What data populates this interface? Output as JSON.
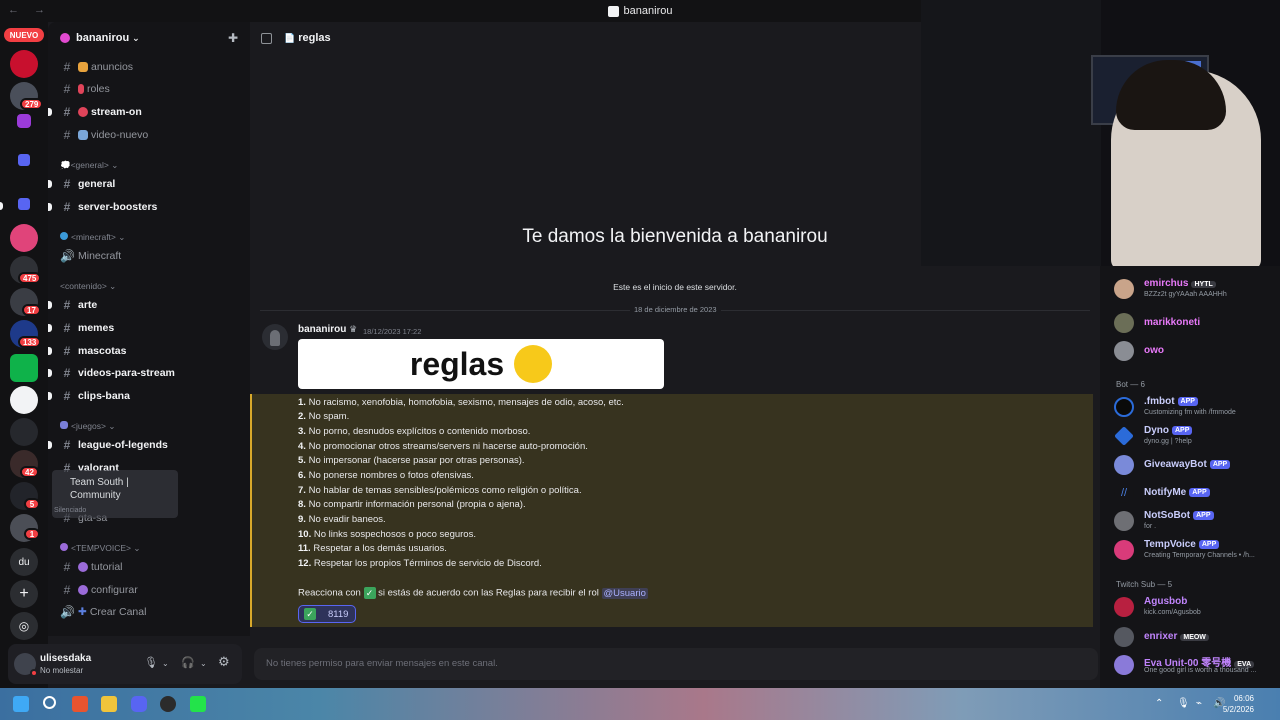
{
  "window": {
    "title": "bananirou",
    "nav": "← →"
  },
  "rail": {
    "nuevo_label": "NUEVO",
    "badges": [
      "279",
      "475",
      "17",
      "133",
      "42",
      "5",
      "1"
    ],
    "du_label": "du",
    "add_icon": "plus-icon",
    "discover_icon": "compass-icon"
  },
  "sidebar": {
    "server_name": "bananirou",
    "channels_top": [
      {
        "name": "anuncios",
        "bold": false
      },
      {
        "name": "roles",
        "bold": false
      },
      {
        "name": "stream-on",
        "bold": true
      },
      {
        "name": "video-nuevo",
        "bold": false
      }
    ],
    "cat_general": "💭<general>",
    "channels_general": [
      "general",
      "server-boosters"
    ],
    "cat_minecraft": "<minecraft>",
    "channel_minecraft": "Minecraft",
    "cat_contenido": "<contenido>",
    "channels_contenido": [
      "arte",
      "memes",
      "mascotas",
      "videos-para-stream",
      "clips-bana"
    ],
    "cat_juegos": "<juegos>",
    "channels_juegos": [
      "league-of-legends",
      "valorant",
      "gta-sa"
    ],
    "hover_card": {
      "line1": "Team South |",
      "line2": "Community",
      "sub": "Silenciado"
    },
    "cat_tempvoice": "<TEMPVOICE>",
    "channels_tempvoice": [
      "tutorial",
      "configurar",
      "Crear Canal"
    ]
  },
  "user_panel": {
    "name": "ulisesdaka",
    "status": "No molestar"
  },
  "chat": {
    "channel_name": "reglas",
    "welcome_title": "Te damos la bienvenida a bananirou",
    "welcome_sub": "Este es el inicio de este servidor.",
    "date_divider": "18 de diciembre de 2023",
    "author": "bananirou",
    "timestamp": "18/12/2023 17:22",
    "image_text": "reglas",
    "rules": [
      {
        "n": "1.",
        "t": "No racismo, xenofobia, homofobia, sexismo, mensajes de odio, acoso, etc."
      },
      {
        "n": "2.",
        "t": "No spam."
      },
      {
        "n": "3.",
        "t": "No porno, desnudos explícitos o contenido morboso."
      },
      {
        "n": "4.",
        "t": "No promocionar otros streams/servers ni hacerse auto-promoción."
      },
      {
        "n": "5.",
        "t": "No impersonar (hacerse pasar por otras personas)."
      },
      {
        "n": "6.",
        "t": "No ponerse nombres o fotos ofensivas."
      },
      {
        "n": "7.",
        "t": "No hablar de temas sensibles/polémicos como religión o política."
      },
      {
        "n": "8.",
        "t": "No compartir información personal (propia o ajena)."
      },
      {
        "n": "9.",
        "t": "No evadir baneos."
      },
      {
        "n": "10.",
        "t": "No links sospechosos o poco seguros."
      },
      {
        "n": "11.",
        "t": "Respetar a los demás usuarios."
      },
      {
        "n": "12.",
        "t": "Respetar los propios Términos de servicio de Discord."
      }
    ],
    "react_before": "Reacciona con",
    "react_after": "si estás de acuerdo con las Reglas para recibir el rol",
    "role_mention": "@Usuario",
    "reaction_count": "8119",
    "composer_placeholder": "No tienes permiso para enviar mensajes en este canal."
  },
  "members": {
    "top": [
      {
        "name": "emirchus",
        "tag": "HYTL",
        "sub": "BZZz2t gyYAAah AAAHHh",
        "color": "#e879f9"
      },
      {
        "name": "marikkoneti",
        "tag": "",
        "sub": "",
        "color": "#e879f9"
      },
      {
        "name": "owo",
        "tag": "",
        "sub": "",
        "color": "#e879f9"
      }
    ],
    "bot_group": "Bot — 6",
    "bots": [
      {
        "name": ".fmbot",
        "sub": "Customizing fm with /fmmode"
      },
      {
        "name": "Dyno",
        "sub": "dyno.gg | ?help"
      },
      {
        "name": "GiveawayBot",
        "sub": ""
      },
      {
        "name": "NotifyMe",
        "sub": ""
      },
      {
        "name": "NotSoBot",
        "sub": "for ."
      },
      {
        "name": "TempVoice",
        "sub": "Creating Temporary Channels • /h..."
      }
    ],
    "app_tag": "APP",
    "twitch_group": "Twitch Sub — 5",
    "subs": [
      {
        "name": "Agusbob",
        "tag": "",
        "sub": "kick.com/Agusbob",
        "color": "#c084fc"
      },
      {
        "name": "enrixer",
        "tag": "MEOW",
        "sub": "",
        "color": "#c084fc"
      },
      {
        "name": "Eva Unit-00 零号機",
        "tag": "EVA",
        "sub": "One good girl is worth a thousand ...",
        "color": "#c084fc"
      }
    ]
  },
  "taskbar": {
    "time": "06:06",
    "date": "5/2/2026"
  }
}
